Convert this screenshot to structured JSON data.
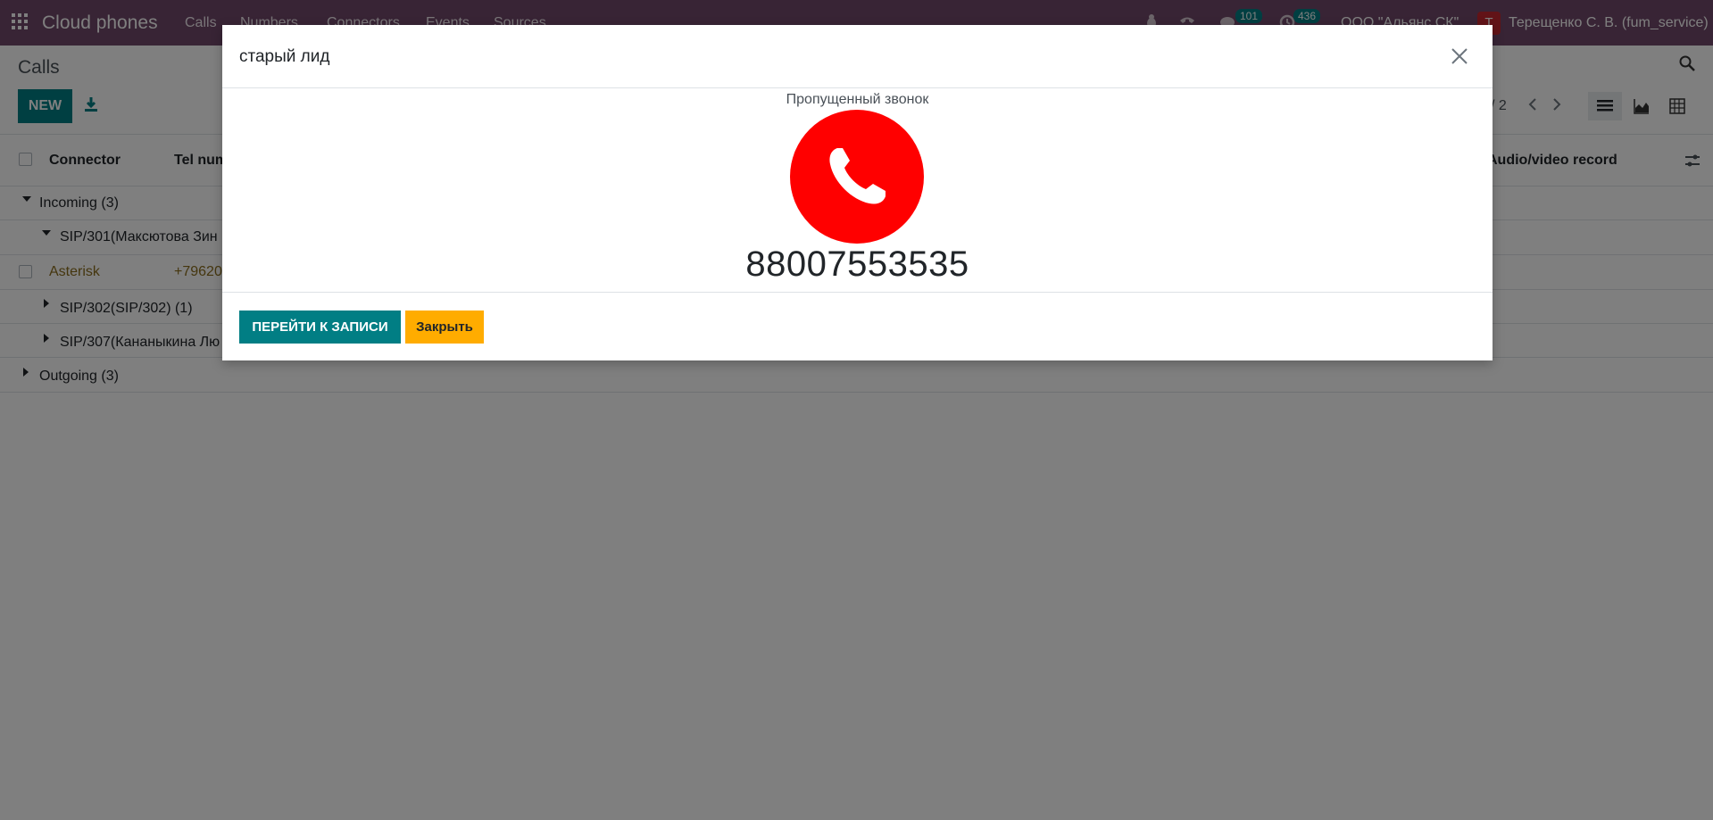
{
  "navbar": {
    "brand": "Cloud phones",
    "menu": [
      "Calls",
      "Numbers",
      "Connectors",
      "Events",
      "Sources"
    ],
    "messages_count": "101",
    "activities_count": "436",
    "company": "ООО \"Альянс СК\"",
    "user_initial": "Т",
    "user_name": "Терещенко С. В. (fum_service)",
    "icons": [
      "apps-icon",
      "bug-icon",
      "phone-icon",
      "chat-icon",
      "clock-icon"
    ],
    "color": "#71496a"
  },
  "control_panel": {
    "title": "Calls",
    "new_label": "NEW",
    "pager": "/ 2",
    "views": [
      "list-view-icon",
      "graph-view-icon",
      "pivot-view-icon"
    ]
  },
  "list": {
    "headers": [
      "Connector",
      "Tel num",
      "Audio/video record"
    ],
    "groups": [
      {
        "label": "Incoming (3)",
        "expanded": true
      },
      {
        "label": "SIP/301(Максютова Зин",
        "expanded": true
      },
      {
        "label": "SIP/302(SIP/302) (1)",
        "expanded": false
      },
      {
        "label": "SIP/307(Кананыкина Лю",
        "expanded": false
      },
      {
        "label": "Outgoing (3)",
        "expanded": false
      }
    ],
    "row": {
      "connector": "Asterisk",
      "tel": "+79620"
    }
  },
  "modal": {
    "title": "старый лид",
    "status": "Пропущенный звонок",
    "number": "88007553535",
    "goto_label": "ПЕРЕЙТИ К ЗАПИСИ",
    "close_label": "Закрыть",
    "circle_color": "#ff0000",
    "goto_color": "#017e84",
    "close_color": "#ffac00"
  }
}
